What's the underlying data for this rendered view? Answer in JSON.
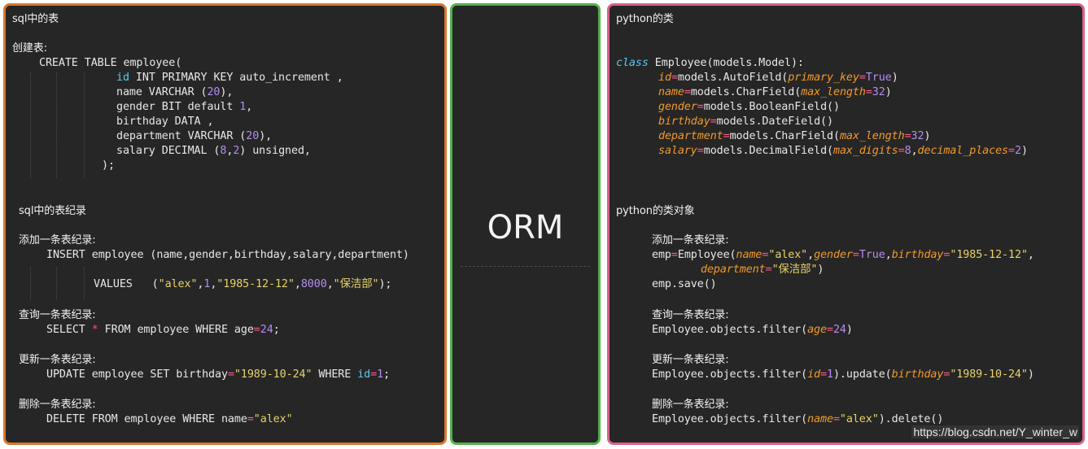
{
  "left": {
    "heading": "sql中的表",
    "create_label": "创建表:",
    "create_lines": [
      "CREATE TABLE employee(",
      "id INT PRIMARY KEY auto_increment ,",
      "name VARCHAR (20),",
      "gender BIT default 1,",
      "birthday DATA ,",
      "department VARCHAR (20),",
      "salary DECIMAL (8,2) unsigned,",
      ");"
    ],
    "records_heading": "sql中的表纪录",
    "add_label": "添加一条表纪录:",
    "insert_line": "INSERT employee (name,gender,birthday,salary,department)",
    "values_line": "VALUES   (\"alex\",1,\"1985-12-12\",8000,\"保洁部\");",
    "query_label": "查询一条表纪录:",
    "select_line": "SELECT * FROM employee WHERE age=24;",
    "update_label": "更新一条表纪录:",
    "update_line": "UPDATE employee SET birthday=\"1989-10-24\" WHERE id=1;",
    "delete_label": "删除一条表纪录:",
    "delete_line": "DELETE FROM employee WHERE name=\"alex\""
  },
  "middle": {
    "title": "ORM"
  },
  "right": {
    "heading": "python的类",
    "class_lines": [
      "class Employee(models.Model):",
      "id=models.AutoField(primary_key=True)",
      "name=models.CharField(max_length=32)",
      "gender=models.BooleanField()",
      "birthday=models.DateField()",
      "department=models.CharField(max_length=32)",
      "salary=models.DecimalField(max_digits=8,decimal_places=2)"
    ],
    "objects_heading": "python的类对象",
    "add_label": "添加一条表纪录:",
    "emp_line1": "emp=Employee(name=\"alex\",gender=True,birthday=\"1985-12-12\",",
    "emp_line2": "department=\"保洁部\")",
    "save_line": "emp.save()",
    "query_label": "查询一条表纪录:",
    "filter_line": "Employee.objects.filter(age=24)",
    "update_label": "更新一条表纪录:",
    "update_line": "Employee.objects.filter(id=1).update(birthday=\"1989-10-24\")",
    "delete_label": "删除一条表纪录:",
    "delete_line": "Employee.objects.filter(name=\"alex\").delete()"
  },
  "watermark": "https://blog.csdn.net/Y_winter_w",
  "colors": {
    "left_border": "#d9772e",
    "middle_border": "#53b04a",
    "right_border": "#d9608c",
    "panel_bg": "#262626"
  }
}
